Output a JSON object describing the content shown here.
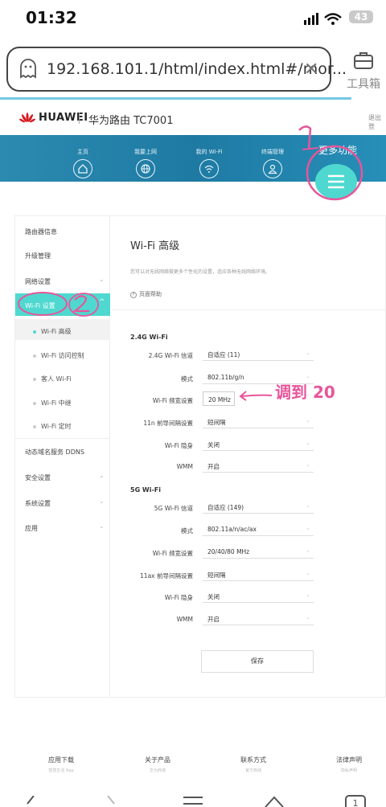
{
  "status": {
    "time": "01:32",
    "battery": "43"
  },
  "browser": {
    "url": "192.168.101.1/html/index.html#/mor...",
    "tools_label": "工具箱"
  },
  "brand": {
    "name": "HUAWEI",
    "model": "华为路由 TC7001",
    "logout": "退出登"
  },
  "nav": {
    "items": [
      {
        "label": "主页"
      },
      {
        "label": "我要上网"
      },
      {
        "label": "我的 Wi-Fi"
      },
      {
        "label": "终端管理"
      }
    ],
    "more_label": "更多功能"
  },
  "sidebar": {
    "items": [
      {
        "label": "路由器信息"
      },
      {
        "label": "升级管理"
      },
      {
        "label": "网络设置"
      },
      {
        "label": "Wi-Fi 设置"
      },
      {
        "label": "动态域名服务 DDNS"
      },
      {
        "label": "安全设置"
      },
      {
        "label": "系统设置"
      },
      {
        "label": "应用"
      }
    ],
    "subitems": [
      {
        "label": "Wi-Fi 高级"
      },
      {
        "label": "Wi-Fi 访问控制"
      },
      {
        "label": "客人 Wi-Fi"
      },
      {
        "label": "Wi-Fi 中继"
      },
      {
        "label": "Wi-Fi 定时"
      }
    ]
  },
  "content": {
    "title": "Wi-Fi 高级",
    "desc": "您可以对无线网络做更多个性化的设置，适应各种无线网络环境。",
    "help": "页面帮助",
    "wifi24": {
      "header": "2.4G Wi-Fi",
      "fields": [
        {
          "label": "2.4G Wi-Fi 信道",
          "value": "自适应 (11)"
        },
        {
          "label": "模式",
          "value": "802.11b/g/n"
        },
        {
          "label": "Wi-Fi 频宽设置",
          "value": "20 MHz"
        },
        {
          "label": "11n 前导间隔设置",
          "value": "短间隔"
        },
        {
          "label": "Wi-Fi 隐身",
          "value": "关闭"
        },
        {
          "label": "WMM",
          "value": "开启"
        }
      ]
    },
    "wifi5": {
      "header": "5G Wi-Fi",
      "fields": [
        {
          "label": "5G Wi-Fi 信道",
          "value": "自适应 (149)"
        },
        {
          "label": "模式",
          "value": "802.11a/n/ac/ax"
        },
        {
          "label": "Wi-Fi 频宽设置",
          "value": "20/40/80 MHz"
        },
        {
          "label": "11ax 前导间隔设置",
          "value": "短间隔"
        },
        {
          "label": "Wi-Fi 隐身",
          "value": "关闭"
        },
        {
          "label": "WMM",
          "value": "开启"
        }
      ]
    },
    "save": "保存"
  },
  "annotation": {
    "text": "调到 20",
    "mark1": "1",
    "mark2": "2"
  },
  "footer": [
    {
      "label": "应用下载",
      "sub": "智慧生活 App"
    },
    {
      "label": "关于产品",
      "sub": "华为商城"
    },
    {
      "label": "联系方式",
      "sub": "官方热线"
    },
    {
      "label": "法律声明",
      "sub": "隐私声明"
    }
  ],
  "colors": {
    "accent": "#4fd8d0",
    "nav": "#1e7aa3",
    "annotation": "#e8559a"
  }
}
